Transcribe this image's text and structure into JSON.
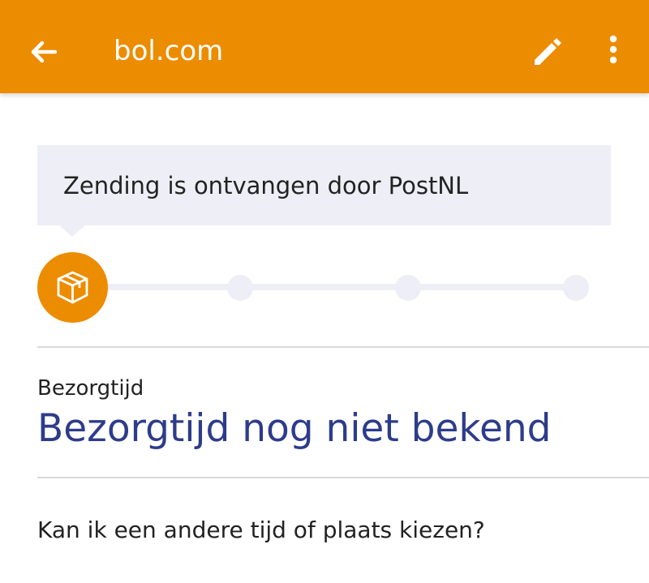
{
  "appbar": {
    "title": "bol.com",
    "back_icon": "arrow-left-icon",
    "edit_icon": "pencil-icon",
    "more_icon": "more-vertical-icon",
    "background": "#ec8c00"
  },
  "tracking": {
    "status_message": "Zending is ontvangen door PostNL",
    "current_step": 1,
    "total_steps": 4,
    "active_step_icon": "package-icon",
    "accent_color": "#ec8c00"
  },
  "delivery": {
    "label": "Bezorgtijd",
    "value": "Bezorgtijd nog niet bekend",
    "value_color": "#2d3c8a"
  },
  "options": {
    "change_link": "Kan ik een andere tijd of plaats kiezen?"
  }
}
